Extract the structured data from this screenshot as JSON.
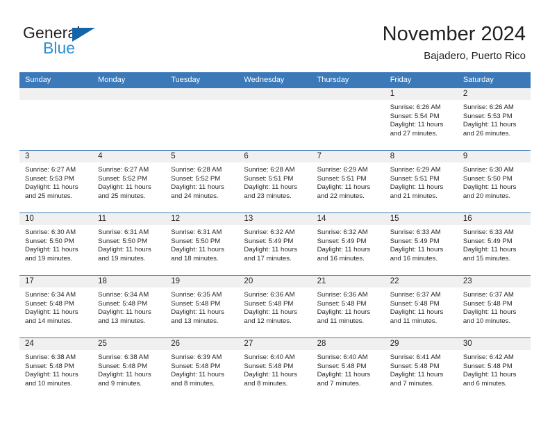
{
  "brand": {
    "name_dark": "General",
    "name_light": "Blue",
    "triangle_color": "#1464aa",
    "light_color": "#2b8fd4"
  },
  "header": {
    "title": "November 2024",
    "subtitle": "Bajadero, Puerto Rico"
  },
  "colors": {
    "header_blue": "#3b79b8",
    "daynum_band": "#f0f0f0",
    "text": "#231f20"
  },
  "weekdays": [
    "Sunday",
    "Monday",
    "Tuesday",
    "Wednesday",
    "Thursday",
    "Friday",
    "Saturday"
  ],
  "labels": {
    "sunrise_prefix": "Sunrise:",
    "sunset_prefix": "Sunset:",
    "daylight_prefix": "Daylight:"
  },
  "weeks": [
    [
      {
        "day": "",
        "empty": true
      },
      {
        "day": "",
        "empty": true
      },
      {
        "day": "",
        "empty": true
      },
      {
        "day": "",
        "empty": true
      },
      {
        "day": "",
        "empty": true
      },
      {
        "day": "1",
        "sunrise": "Sunrise: 6:26 AM",
        "sunset": "Sunset: 5:54 PM",
        "daylight": "Daylight: 11 hours and 27 minutes."
      },
      {
        "day": "2",
        "sunrise": "Sunrise: 6:26 AM",
        "sunset": "Sunset: 5:53 PM",
        "daylight": "Daylight: 11 hours and 26 minutes."
      }
    ],
    [
      {
        "day": "3",
        "sunrise": "Sunrise: 6:27 AM",
        "sunset": "Sunset: 5:53 PM",
        "daylight": "Daylight: 11 hours and 25 minutes."
      },
      {
        "day": "4",
        "sunrise": "Sunrise: 6:27 AM",
        "sunset": "Sunset: 5:52 PM",
        "daylight": "Daylight: 11 hours and 25 minutes."
      },
      {
        "day": "5",
        "sunrise": "Sunrise: 6:28 AM",
        "sunset": "Sunset: 5:52 PM",
        "daylight": "Daylight: 11 hours and 24 minutes."
      },
      {
        "day": "6",
        "sunrise": "Sunrise: 6:28 AM",
        "sunset": "Sunset: 5:51 PM",
        "daylight": "Daylight: 11 hours and 23 minutes."
      },
      {
        "day": "7",
        "sunrise": "Sunrise: 6:29 AM",
        "sunset": "Sunset: 5:51 PM",
        "daylight": "Daylight: 11 hours and 22 minutes."
      },
      {
        "day": "8",
        "sunrise": "Sunrise: 6:29 AM",
        "sunset": "Sunset: 5:51 PM",
        "daylight": "Daylight: 11 hours and 21 minutes."
      },
      {
        "day": "9",
        "sunrise": "Sunrise: 6:30 AM",
        "sunset": "Sunset: 5:50 PM",
        "daylight": "Daylight: 11 hours and 20 minutes."
      }
    ],
    [
      {
        "day": "10",
        "sunrise": "Sunrise: 6:30 AM",
        "sunset": "Sunset: 5:50 PM",
        "daylight": "Daylight: 11 hours and 19 minutes."
      },
      {
        "day": "11",
        "sunrise": "Sunrise: 6:31 AM",
        "sunset": "Sunset: 5:50 PM",
        "daylight": "Daylight: 11 hours and 19 minutes."
      },
      {
        "day": "12",
        "sunrise": "Sunrise: 6:31 AM",
        "sunset": "Sunset: 5:50 PM",
        "daylight": "Daylight: 11 hours and 18 minutes."
      },
      {
        "day": "13",
        "sunrise": "Sunrise: 6:32 AM",
        "sunset": "Sunset: 5:49 PM",
        "daylight": "Daylight: 11 hours and 17 minutes."
      },
      {
        "day": "14",
        "sunrise": "Sunrise: 6:32 AM",
        "sunset": "Sunset: 5:49 PM",
        "daylight": "Daylight: 11 hours and 16 minutes."
      },
      {
        "day": "15",
        "sunrise": "Sunrise: 6:33 AM",
        "sunset": "Sunset: 5:49 PM",
        "daylight": "Daylight: 11 hours and 16 minutes."
      },
      {
        "day": "16",
        "sunrise": "Sunrise: 6:33 AM",
        "sunset": "Sunset: 5:49 PM",
        "daylight": "Daylight: 11 hours and 15 minutes."
      }
    ],
    [
      {
        "day": "17",
        "sunrise": "Sunrise: 6:34 AM",
        "sunset": "Sunset: 5:48 PM",
        "daylight": "Daylight: 11 hours and 14 minutes."
      },
      {
        "day": "18",
        "sunrise": "Sunrise: 6:34 AM",
        "sunset": "Sunset: 5:48 PM",
        "daylight": "Daylight: 11 hours and 13 minutes."
      },
      {
        "day": "19",
        "sunrise": "Sunrise: 6:35 AM",
        "sunset": "Sunset: 5:48 PM",
        "daylight": "Daylight: 11 hours and 13 minutes."
      },
      {
        "day": "20",
        "sunrise": "Sunrise: 6:36 AM",
        "sunset": "Sunset: 5:48 PM",
        "daylight": "Daylight: 11 hours and 12 minutes."
      },
      {
        "day": "21",
        "sunrise": "Sunrise: 6:36 AM",
        "sunset": "Sunset: 5:48 PM",
        "daylight": "Daylight: 11 hours and 11 minutes."
      },
      {
        "day": "22",
        "sunrise": "Sunrise: 6:37 AM",
        "sunset": "Sunset: 5:48 PM",
        "daylight": "Daylight: 11 hours and 11 minutes."
      },
      {
        "day": "23",
        "sunrise": "Sunrise: 6:37 AM",
        "sunset": "Sunset: 5:48 PM",
        "daylight": "Daylight: 11 hours and 10 minutes."
      }
    ],
    [
      {
        "day": "24",
        "sunrise": "Sunrise: 6:38 AM",
        "sunset": "Sunset: 5:48 PM",
        "daylight": "Daylight: 11 hours and 10 minutes."
      },
      {
        "day": "25",
        "sunrise": "Sunrise: 6:38 AM",
        "sunset": "Sunset: 5:48 PM",
        "daylight": "Daylight: 11 hours and 9 minutes."
      },
      {
        "day": "26",
        "sunrise": "Sunrise: 6:39 AM",
        "sunset": "Sunset: 5:48 PM",
        "daylight": "Daylight: 11 hours and 8 minutes."
      },
      {
        "day": "27",
        "sunrise": "Sunrise: 6:40 AM",
        "sunset": "Sunset: 5:48 PM",
        "daylight": "Daylight: 11 hours and 8 minutes."
      },
      {
        "day": "28",
        "sunrise": "Sunrise: 6:40 AM",
        "sunset": "Sunset: 5:48 PM",
        "daylight": "Daylight: 11 hours and 7 minutes."
      },
      {
        "day": "29",
        "sunrise": "Sunrise: 6:41 AM",
        "sunset": "Sunset: 5:48 PM",
        "daylight": "Daylight: 11 hours and 7 minutes."
      },
      {
        "day": "30",
        "sunrise": "Sunrise: 6:42 AM",
        "sunset": "Sunset: 5:48 PM",
        "daylight": "Daylight: 11 hours and 6 minutes."
      }
    ]
  ]
}
